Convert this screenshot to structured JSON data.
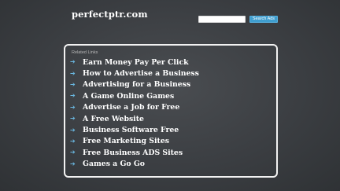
{
  "header": {
    "logo_text": "perfectptr.com",
    "search_placeholder": "",
    "search_button_label": "Search Ads"
  },
  "panel": {
    "heading": "Related Links",
    "links": [
      {
        "label": "Earn Money Pay Per Click",
        "icon": "arrow-right-icon"
      },
      {
        "label": "How to Advertise a Business",
        "icon": "arrow-right-icon"
      },
      {
        "label": "Advertising for a Business",
        "icon": "arrow-right-icon"
      },
      {
        "label": "A Game Online Games",
        "icon": "arrow-right-icon"
      },
      {
        "label": "Advertise a Job for Free",
        "icon": "arrow-right-icon"
      },
      {
        "label": "A Free Website",
        "icon": "arrow-right-icon"
      },
      {
        "label": "Business Software Free",
        "icon": "arrow-right-icon"
      },
      {
        "label": "Free Marketing Sites",
        "icon": "arrow-right-icon"
      },
      {
        "label": "Free Business ADS Sites",
        "icon": "arrow-right-icon"
      },
      {
        "label": "Games a Go Go",
        "icon": "arrow-right-icon"
      }
    ]
  },
  "colors": {
    "background": "#3b3e42",
    "accent": "#3f9ecf",
    "arrow": "#6ab7e0",
    "text": "#ffffff"
  }
}
